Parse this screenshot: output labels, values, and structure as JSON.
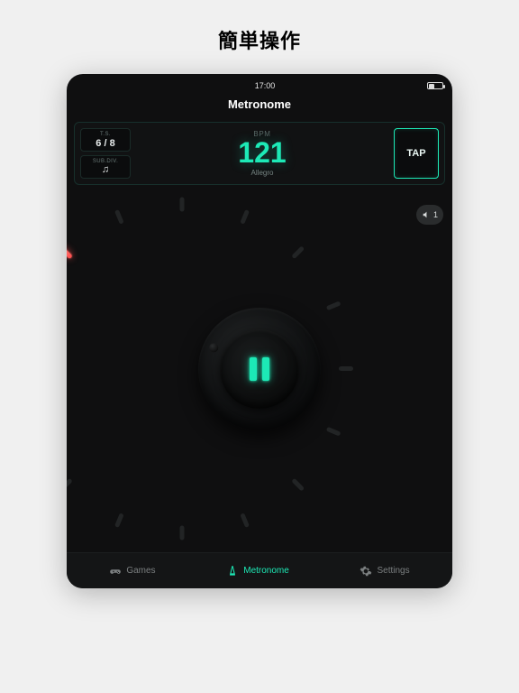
{
  "page": {
    "title": "簡単操作"
  },
  "status": {
    "time": "17:00"
  },
  "appbar": {
    "title": "Metronome"
  },
  "top": {
    "ts_label": "T.S.",
    "ts_value": "6 / 8",
    "subdiv_label": "SUB.DIV.",
    "subdiv_value": "♫",
    "bpm_label": "BPM",
    "bpm_value": "121",
    "tempo_name": "Allegro",
    "tap_label": "TAP"
  },
  "volume": {
    "level": "1"
  },
  "dial": {
    "tick_count": 16,
    "active_ticks": [
      12,
      13,
      14
    ],
    "pointer_angle_deg": 205
  },
  "tabs": {
    "games": "Games",
    "metronome": "Metronome",
    "settings": "Settings"
  },
  "colors": {
    "accent": "#1de9b6",
    "beat_glow": "#ff4d4d",
    "bg": "#0f0f10"
  }
}
